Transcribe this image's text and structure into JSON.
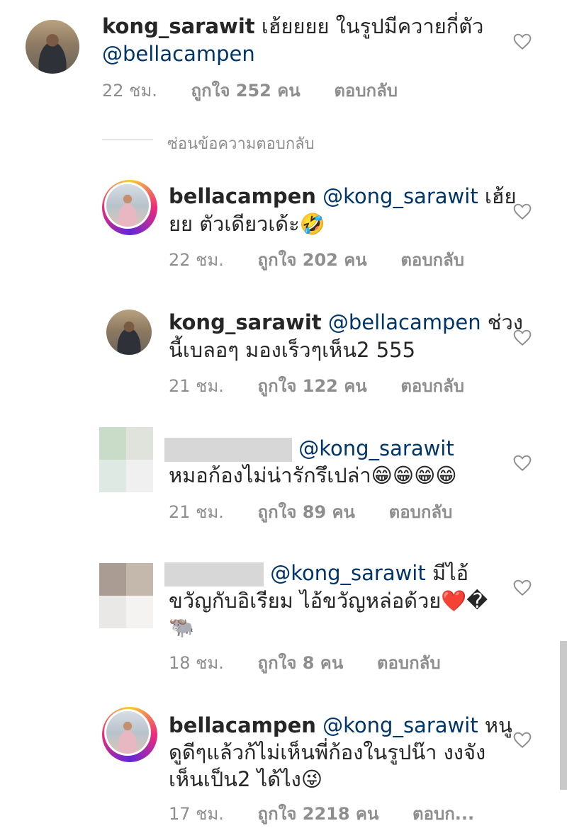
{
  "comments": [
    {
      "username": "kong_sarawit",
      "text_line1": " เฮ้ยยยย ในรูปมีควายกี่ตัว",
      "text_line2": "@bellacampen",
      "time": "22 ชม.",
      "likes": "ถูกใจ 252 คน",
      "reply": "ตอบกลับ"
    },
    {
      "username": "bellacampen",
      "mention": "@kong_sarawit",
      "text_line1_tail": " เฮ้ย",
      "text_line2": "ยย ตัวเดียวเด้ะ🤣",
      "time": "22 ชม.",
      "likes": "ถูกใจ 202 คน",
      "reply": "ตอบกลับ"
    },
    {
      "username": "kong_sarawit",
      "mention": "@bellacampen",
      "text_line1_tail": " ช่วง",
      "text_line2": "นี้เบลอๆ มองเร็วๆเห็น2 555",
      "time": "21 ชม.",
      "likes": "ถูกใจ 122 คน",
      "reply": "ตอบกลับ"
    },
    {
      "mention": "@kong_sarawit",
      "text_line2": "หมอก้องไม่น่ารักรึเปล่า😁😁😁😁",
      "time": "21 ชม.",
      "likes": "ถูกใจ 89 คน",
      "reply": "ตอบกลับ"
    },
    {
      "mention": "@kong_sarawit",
      "text_line1_tail": " มีไอ้",
      "text_line2": "ขวัญกับอิเรียม ไอ้ขวัญหล่อด้วย❤️",
      "text_line2_tail": "�",
      "text_line3": "🐃",
      "time": "18 ชม.",
      "likes": "ถูกใจ 8 คน",
      "reply": "ตอบกลับ"
    },
    {
      "username": "bellacampen",
      "mention": "@kong_sarawit",
      "text_line1_tail": " หนู",
      "text_line2": "ดูดีๆแล้วก้ไม่เห็นพี่ก้องในรูปน๊า งงจัง",
      "text_line3": "เห็นเป็น2 ได้ไง😜",
      "time": "17 ชม.",
      "likes": "ถูกใจ 2218 คน",
      "reply": "ตอบก..."
    }
  ],
  "hidden_replies_label": "ซ่อนข้อความตอบกลับ",
  "colors": {
    "text": "#262626",
    "meta": "#8e8e8e",
    "mention": "#003569"
  }
}
